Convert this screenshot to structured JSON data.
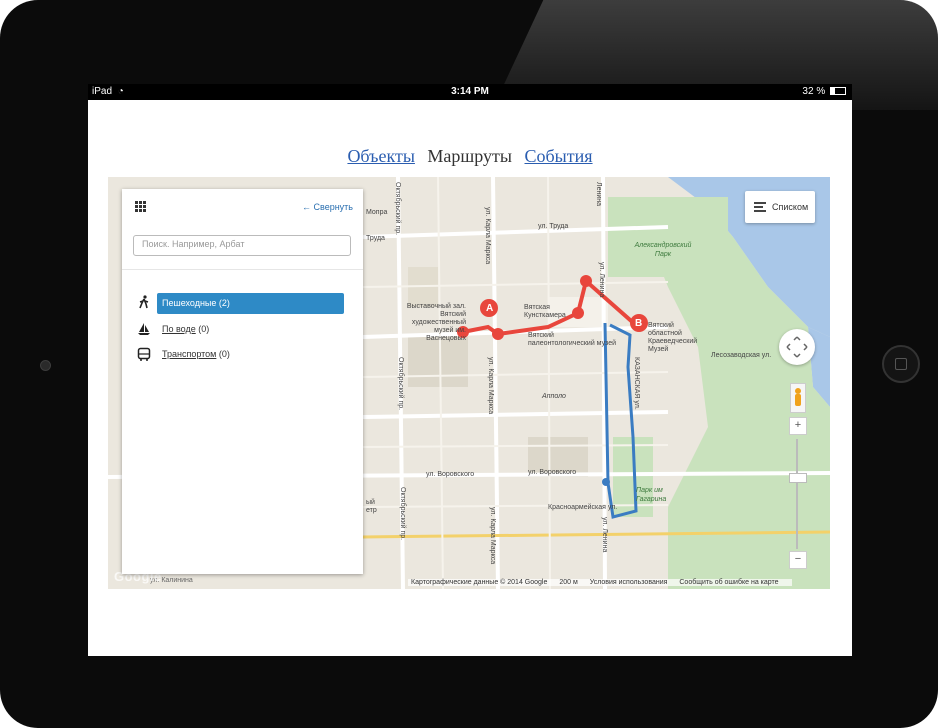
{
  "status_bar": {
    "device": "iPad",
    "time": "3:14 PM",
    "battery": "32 %",
    "battery_level": 0.32
  },
  "nav": {
    "items": [
      {
        "label": "Объекты",
        "active": false
      },
      {
        "label": "Маршруты",
        "active": true
      },
      {
        "label": "События",
        "active": false
      }
    ]
  },
  "panel": {
    "collapse_label": "← Свернуть",
    "search_placeholder": "Поиск. Например, Арбат",
    "categories": [
      {
        "label": "Пешеходные",
        "count": "(2)",
        "icon": "walking-person-icon",
        "selected": true
      },
      {
        "label": "По воде",
        "count": "(0)",
        "icon": "sailboat-icon",
        "selected": false
      },
      {
        "label": "Транспортом",
        "count": "(0)",
        "icon": "bus-icon",
        "selected": false
      }
    ]
  },
  "map": {
    "list_button": "Списком",
    "zoom_in": "+",
    "zoom_out": "−",
    "google_logo": "Google",
    "attribution": {
      "data": "Картографические данные © 2014 Google",
      "scale": "200 м",
      "terms": "Условия использования",
      "report": "Сообщить об ошибке на карте"
    },
    "markers": [
      {
        "label": "A"
      },
      {
        "label": "B"
      }
    ],
    "route_colors": {
      "walking_red": "#e8463c",
      "walking_blue": "#3a7cc2"
    },
    "labels": {
      "truda_1": "ул. Труда",
      "truda_2": "Труда",
      "truda_3": "Мопра",
      "karla_marksa_1": "ул. Карла Маркса",
      "karla_marksa_2": "ул. Карла Маркса",
      "karla_marksa_3": "ул. Карла Маркса",
      "oktyabrsky_1": "Октябрьский пр.",
      "oktyabrsky_2": "Октябрьский пр.",
      "oktyabrsky_3": "Октябрьский пр.",
      "lenina_1": "ул. Ленина",
      "lenina_2": "ул. Ленина",
      "lenina_3": "Ленина",
      "vorovskogo_1": "ул. Воровского",
      "vorovskogo_2": "ул. Воровского",
      "kalinina": "ул. Калинина",
      "krasnoarmeyskaya": "Красноармейская ул.",
      "kazanskaya": "КАЗАНСКАЯ ул.",
      "lesozavodskaya": "Лесозаводская ул.",
      "mopra_extra": "ул. Мопра",
      "vystavochny": "Выставочный зал. Вятский художественный музей им. Васнецовых",
      "kunstkamera": "Вятская Кунсткамера",
      "paleo": "Вятский палеонтологический музей",
      "oblastnoy": "Вятский областной Краеведческий Музей",
      "appolo": "Апполо",
      "aleksandrovsky_park": "Александровский Парк",
      "park_gagarina": "Парк им Гагарина",
      "yi_etr": "ый етр",
      "lesozavod_2": "ул. Лесозаводская",
      "mopra_2": "ул. Мопра"
    }
  }
}
